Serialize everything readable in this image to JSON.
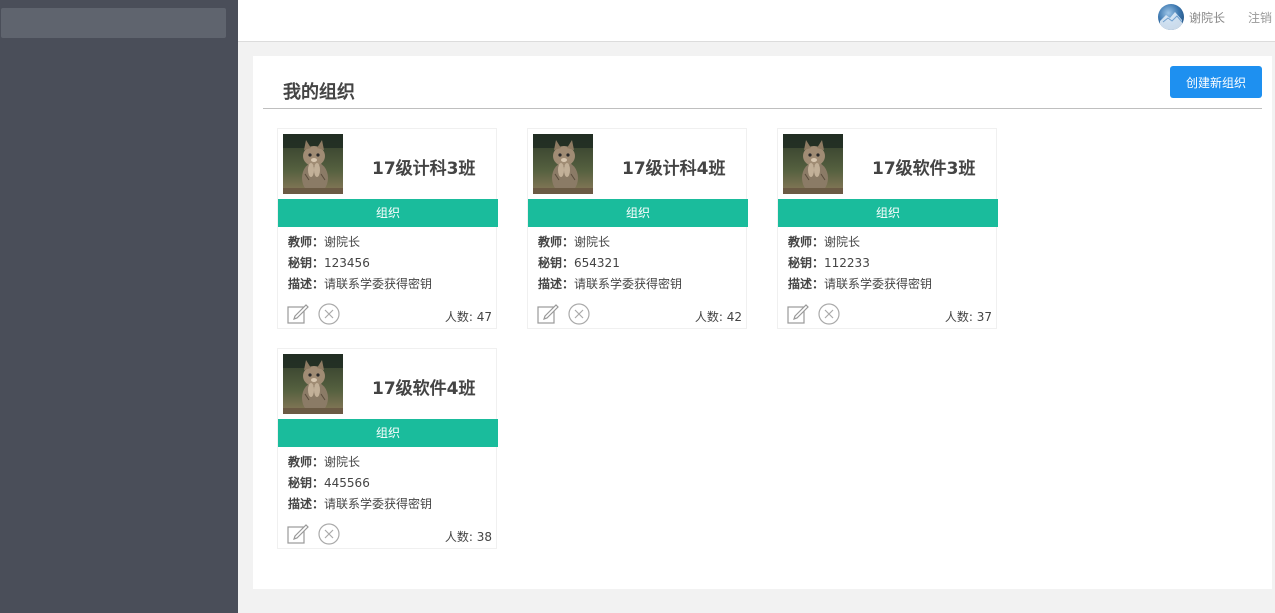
{
  "header": {
    "user_name": "谢院长",
    "logout_label": "注销",
    "avatar_icon": "user-avatar"
  },
  "main": {
    "title": "我的组织",
    "create_button_label": "创建新组织"
  },
  "labels": {
    "teacher": "教师：",
    "key": "秘钥：",
    "desc": "描述：",
    "count": "人数: "
  },
  "colors": {
    "sidebar": "#4a4e59",
    "accent_green": "#1abc9c",
    "primary_blue": "#1e90f0"
  },
  "cards": [
    {
      "name": "17级计科3班",
      "tag": "组织",
      "teacher": "谢院长",
      "key": "123456",
      "desc": "请联系学委获得密钥",
      "count": "47"
    },
    {
      "name": "17级计科4班",
      "tag": "组织",
      "teacher": "谢院长",
      "key": "654321",
      "desc": "请联系学委获得密钥",
      "count": "42"
    },
    {
      "name": "17级软件3班",
      "tag": "组织",
      "teacher": "谢院长",
      "key": "112233",
      "desc": "请联系学委获得密钥",
      "count": "37"
    },
    {
      "name": "17级软件4班",
      "tag": "组织",
      "teacher": "谢院长",
      "key": "445566",
      "desc": "请联系学委获得密钥",
      "count": "38"
    }
  ]
}
